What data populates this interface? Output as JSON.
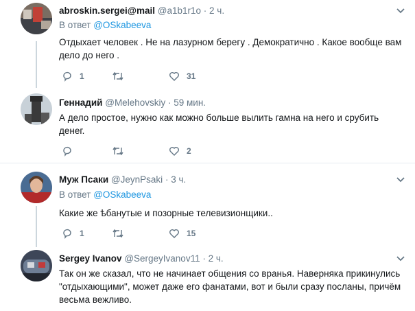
{
  "tweets": [
    {
      "name": "abroskin.sergei@mail",
      "handle": "@a1b1r1o",
      "dot": "·",
      "time": "2 ч.",
      "reply_prefix": "В ответ",
      "reply_to": "@OSkabeeva",
      "text": "Отдыхает человек . Не на лазурном берегу . Демократично . Какое вообще вам дело  до него .",
      "replies": "1",
      "retweets": "",
      "likes": "31"
    },
    {
      "name": "Геннадий",
      "handle": "@Melehovskiy",
      "dot": "·",
      "time": "59 мин.",
      "text": "А дело простое, нужно как можно больше вылить гамна на него и срубить денег.",
      "replies": "",
      "retweets": "",
      "likes": "2"
    },
    {
      "name": "Муж Псаки",
      "handle": "@JeynPsaki",
      "dot": "·",
      "time": "3 ч.",
      "reply_prefix": "В ответ",
      "reply_to": "@OSkabeeva",
      "text": "Какие же ѣбанутые и позорные телевизионщики..",
      "replies": "1",
      "retweets": "",
      "likes": "15"
    },
    {
      "name": "Sergey Ivanov",
      "handle": "@SergeyIvanov11",
      "dot": "·",
      "time": "2 ч.",
      "text": "Так он же сказал, что не начинает общения со вранья. Наверняка прикинулись \"отдыхающими\", может даже его фанатами, вот и были сразу посланы, причём весьма вежливо."
    }
  ],
  "colors": {
    "link": "#1b95e0",
    "muted": "#657786",
    "text": "#14171a",
    "line": "#ccd6dd"
  }
}
